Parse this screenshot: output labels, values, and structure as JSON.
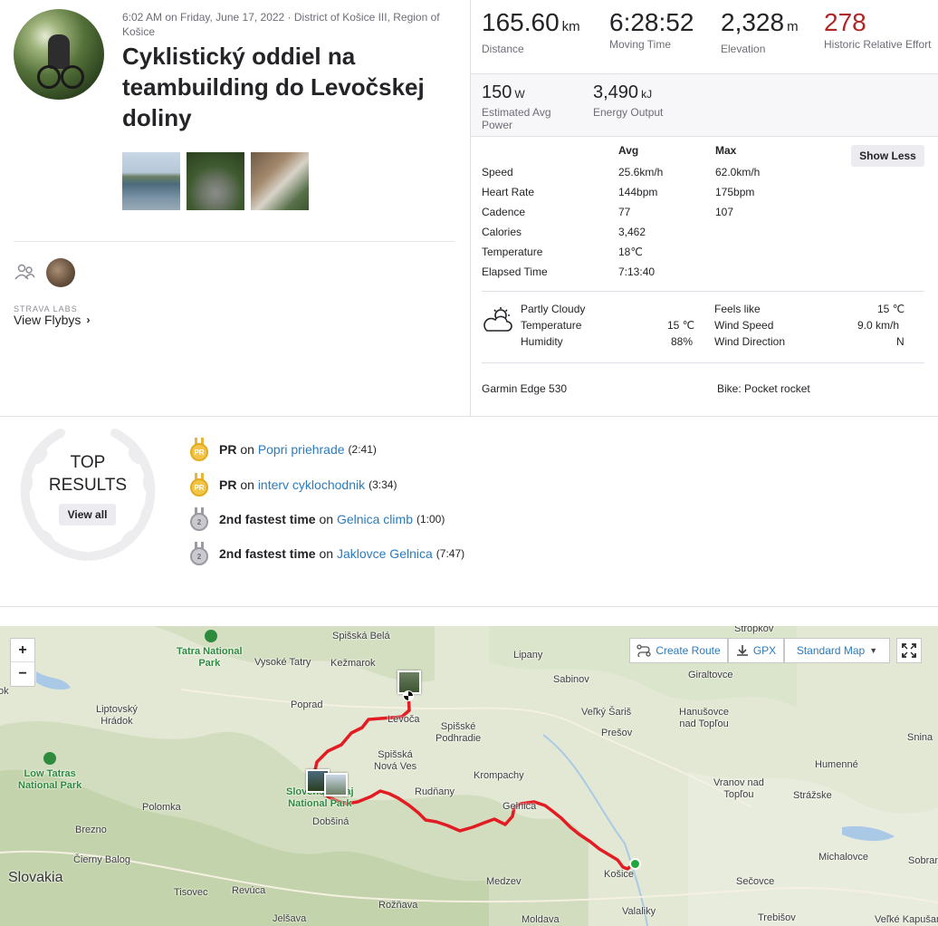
{
  "activity": {
    "meta": "6:02 AM on Friday, June 17, 2022 · District of Košice III, Region of Košice",
    "title": "Cyklistický oddiel na teambuilding do Levočskej doliny"
  },
  "flyby": {
    "labs": "STRAVA LABS",
    "label": "View Flybys",
    "chevron": "›"
  },
  "stats": {
    "distance": {
      "value": "165.60",
      "unit": "km",
      "label": "Distance"
    },
    "moving_time": {
      "value": "6:28:52",
      "label": "Moving Time"
    },
    "elevation": {
      "value": "2,328",
      "unit": "m",
      "label": "Elevation"
    },
    "relative_effort": {
      "value": "278",
      "label": "Historic Relative Effort"
    },
    "power": {
      "value": "150",
      "unit": "W",
      "label": "Estimated Avg Power"
    },
    "energy": {
      "value": "3,490",
      "unit": "kJ",
      "label": "Energy Output"
    }
  },
  "more_stats": {
    "avg_header": "Avg",
    "max_header": "Max",
    "show_less": "Show Less",
    "rows": [
      {
        "label": "Speed",
        "avg": "25.6km/h",
        "max": "62.0km/h"
      },
      {
        "label": "Heart Rate",
        "avg": "144bpm",
        "max": "175bpm"
      },
      {
        "label": "Cadence",
        "avg": "77",
        "max": "107"
      },
      {
        "label": "Calories",
        "avg": "3,462",
        "max": ""
      },
      {
        "label": "Temperature",
        "avg": "18℃",
        "max": ""
      },
      {
        "label": "Elapsed Time",
        "avg": "7:13:40",
        "max": ""
      }
    ]
  },
  "weather": {
    "icon": "partly-cloudy-icon",
    "condition": "Partly Cloudy",
    "temperature_label": "Temperature",
    "temperature_value": "15 ℃",
    "humidity_label": "Humidity",
    "humidity_value": "88%",
    "feels_like_label": "Feels like",
    "feels_like_value": "15 ℃",
    "wind_speed_label": "Wind Speed",
    "wind_speed_value": "9.0 km/h",
    "wind_direction_label": "Wind Direction",
    "wind_direction_value": "N"
  },
  "gear": {
    "device": "Garmin Edge 530",
    "bike": "Bike: Pocket rocket"
  },
  "top_results": {
    "title_line1": "TOP",
    "title_line2": "RESULTS",
    "view_all": "View all",
    "items": [
      {
        "medal": "PR",
        "type": "gold",
        "achievement": "PR",
        "on": "on",
        "segment": "Popri priehrade",
        "time": "(2:41)"
      },
      {
        "medal": "PR",
        "type": "gold",
        "achievement": "PR",
        "on": "on",
        "segment": "interv cyklochodnik",
        "time": "(3:34)"
      },
      {
        "medal": "2",
        "type": "silver",
        "achievement": "2nd fastest time",
        "on": "on",
        "segment": "Gelnica climb",
        "time": "(1:00)"
      },
      {
        "medal": "2",
        "type": "silver",
        "achievement": "2nd fastest time",
        "on": "on",
        "segment": "Jaklovce Gelnica",
        "time": "(7:47)"
      }
    ]
  },
  "map": {
    "zoom_in": "+",
    "zoom_out": "−",
    "create_route": "Create Route",
    "gpx": "GPX",
    "map_type": "Standard Map",
    "route_color": "#e31b23",
    "labels": {
      "spisska_bela": "Spišská Belá",
      "stropkov": "Stropkov",
      "tatra": "Tatra National\nPark",
      "vysoke_tatry": "Vysoké Tatry",
      "kezmarok": "Kežmarok",
      "lipany": "Lipany",
      "sabinov": "Sabinov",
      "giraltovce": "Giraltovce",
      "ok": "ok",
      "liptovsky": "Liptovský\nHrádok",
      "poprad": "Poprad",
      "levoca": "Levoča",
      "velky_saris": "Veľký Šariš",
      "hanusovce": "Hanušovce\nnad Topľou",
      "spisske_podhradie": "Spišské\nPodhradie",
      "presov": "Prešov",
      "snina": "Snina",
      "low_tatras": "Low Tatras\nNational Park",
      "spisska_nova_ves": "Spišská\nNová Ves",
      "humenne": "Humenné",
      "krompachy": "Krompachy",
      "slovensky_raj": "Slovenský Raj\nNational Park",
      "rudnany": "Rudňany",
      "vranov": "Vranov nad\nTopľou",
      "strazske": "Strážske",
      "polomka": "Polomka",
      "gelnica": "Gelnica",
      "dobsina": "Dobšiná",
      "brezno": "Brezno",
      "michalovce": "Michalovce",
      "sobrance": "Sobranc",
      "cierny_balog": "Čierny Balog",
      "kosice": "Košice",
      "slovakia": "Slovakia",
      "medzev": "Medzev",
      "secovce": "Sečovce",
      "tisovec": "Tisovec",
      "revuca": "Revúca",
      "roznava": "Rožňava",
      "valaliky": "Valaliky",
      "trebisov": "Trebišov",
      "jelsava": "Jelšava",
      "moldava": "Moldava",
      "velke_kapusany": "Veľké Kapušany"
    }
  }
}
